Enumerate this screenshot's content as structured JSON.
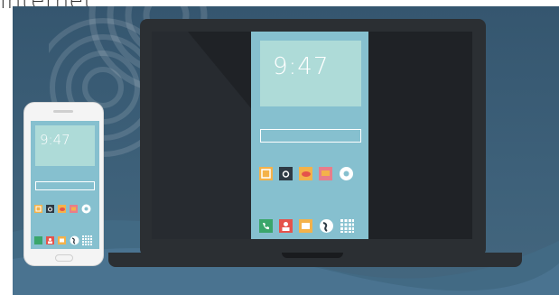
{
  "caption": "internet",
  "laptop": {
    "time": "9:47",
    "app_row": [
      "photos-icon",
      "camera-icon",
      "fish-icon",
      "messages-icon",
      "settings-icon"
    ],
    "dock_row": [
      "phone-icon",
      "contacts-icon",
      "mail-icon",
      "browser-icon",
      "apps-grid-icon"
    ]
  },
  "phone": {
    "time": "9:47",
    "app_row": [
      "photos-icon",
      "camera-icon",
      "fish-icon",
      "messages-icon",
      "settings-icon"
    ],
    "dock_row": [
      "phone-icon",
      "contacts-icon",
      "mail-icon",
      "browser-icon",
      "apps-grid-icon"
    ]
  },
  "colors": {
    "background": "#3d6079",
    "device_dark": "#2b2f33",
    "screen": "#86c0cf",
    "clock_box": "#aedbd8",
    "icon_orange": "#f4b24a",
    "icon_red": "#e5534b",
    "icon_green": "#3aa66b"
  }
}
